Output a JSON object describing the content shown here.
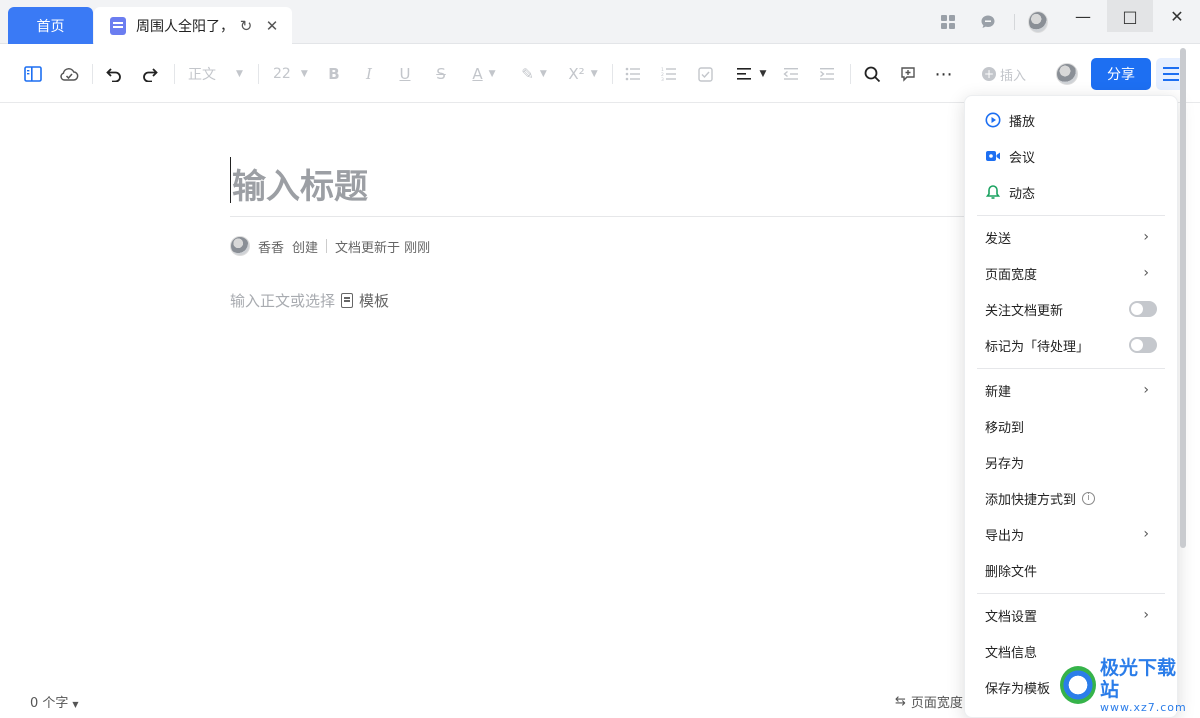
{
  "titlebar": {
    "home_tab": "首页",
    "doc_tab": "周围人全阳了，",
    "refresh_icon": "refresh-icon",
    "close_icon": "close-icon"
  },
  "toolbar": {
    "style_label": "正文",
    "font_size": "22",
    "insert_label": "插入",
    "share_label": "分享"
  },
  "editor": {
    "title_placeholder": "输入标题",
    "author": "香香",
    "created_label": "创建",
    "updated_label": "文档更新于 刚刚",
    "body_placeholder": "输入正文或选择",
    "template_label": "模板"
  },
  "footer": {
    "word_count": "0 个字",
    "page_width_label": "页面宽度"
  },
  "menu": {
    "play": "播放",
    "meeting": "会议",
    "activity": "动态",
    "send": "发送",
    "page_width": "页面宽度",
    "follow_updates": "关注文档更新",
    "mark_pending": "标记为「待处理」",
    "new": "新建",
    "move_to": "移动到",
    "save_as": "另存为",
    "add_shortcut": "添加快捷方式到",
    "export_as": "导出为",
    "delete_file": "删除文件",
    "doc_settings": "文档设置",
    "doc_info": "文档信息",
    "save_as_template": "保存为模板"
  },
  "watermark": {
    "name": "极光下载站",
    "url": "www.xz7.com"
  },
  "colors": {
    "accent": "#1d6ff2",
    "home_tab": "#3a7af5",
    "activity_icon": "#1aa260"
  }
}
